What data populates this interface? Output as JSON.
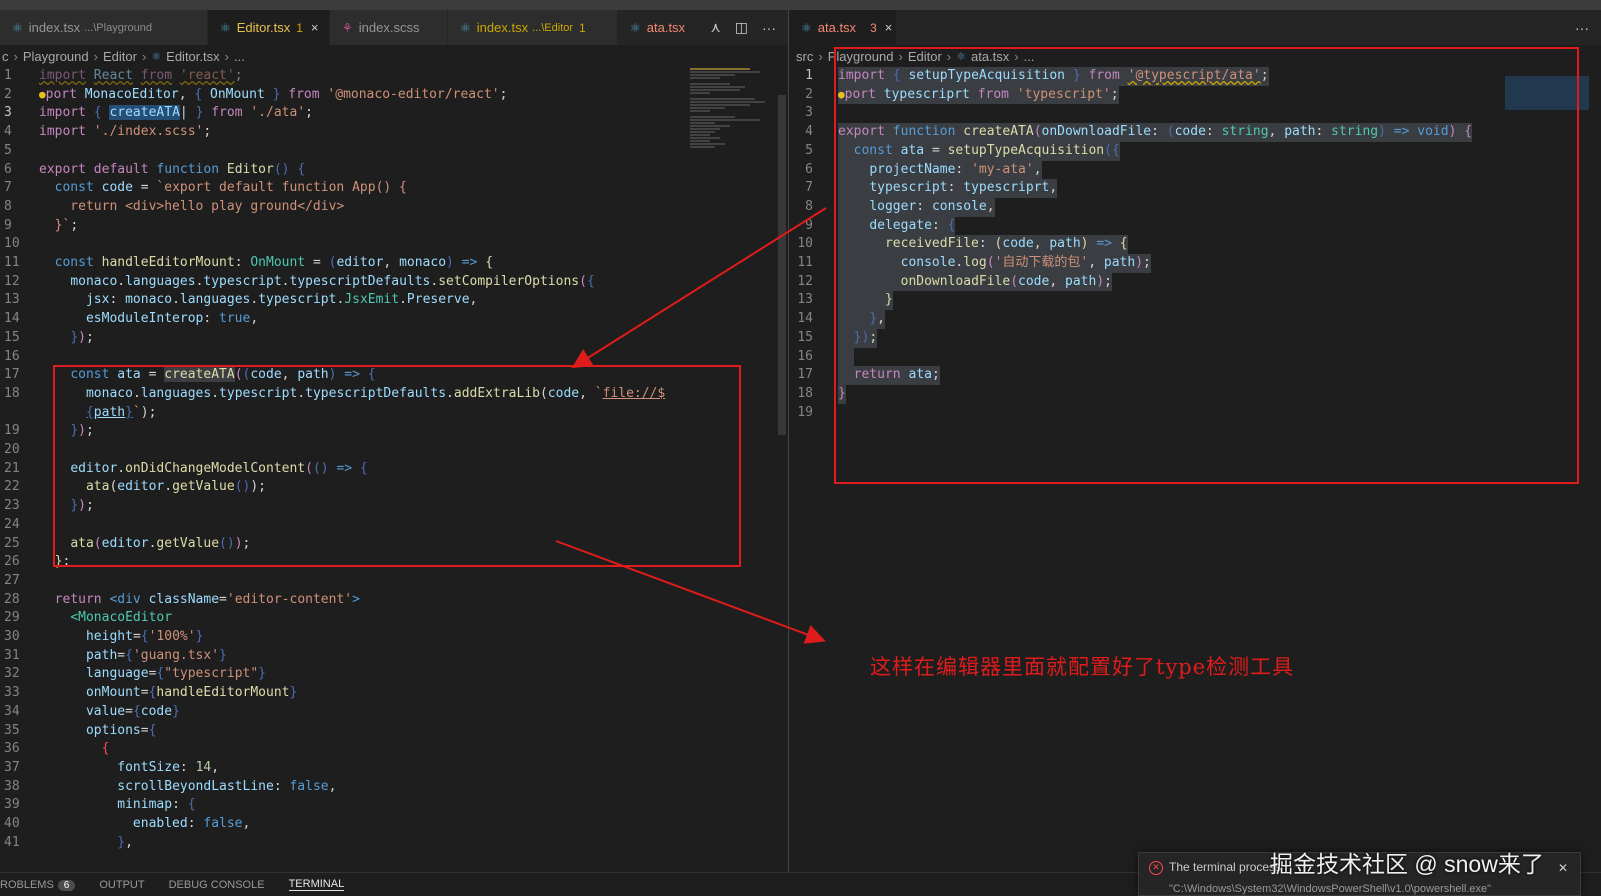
{
  "left": {
    "tabs": [
      {
        "label": "index.tsx",
        "hint": "...\\Playground"
      },
      {
        "label": "Editor.tsx",
        "badge": "1",
        "close": "×"
      },
      {
        "label": "index.scss"
      },
      {
        "label": "index.tsx",
        "hint": "...\\Editor",
        "badge": "1"
      },
      {
        "label": "ata.tsx"
      }
    ],
    "actions": {
      "compare": "⋏",
      "split": "◫",
      "more": "···"
    },
    "breadcrumb": [
      "c",
      "Playground",
      "Editor",
      "Editor.tsx",
      "..."
    ],
    "line_numbers": [
      "1",
      "2",
      "3",
      "4",
      "5",
      "6",
      "7",
      "8",
      "9",
      "10",
      "11",
      "12",
      "13",
      "14",
      "15",
      "16",
      "17",
      "18",
      "",
      "19",
      "20",
      "21",
      "22",
      "23",
      "24",
      "25",
      "26",
      "27",
      "28",
      "29",
      "30",
      "31",
      "32",
      "33",
      "34",
      "35",
      "36",
      "37",
      "38",
      "39",
      "40",
      "41"
    ]
  },
  "right": {
    "tab": {
      "label": "ata.tsx",
      "badge": "3",
      "close": "×"
    },
    "more": "···",
    "breadcrumb": [
      "src",
      "Playground",
      "Editor",
      "ata.tsx",
      "..."
    ],
    "line_numbers": [
      "1",
      "2",
      "3",
      "4",
      "5",
      "6",
      "7",
      "8",
      "9",
      "10",
      "11",
      "12",
      "13",
      "14",
      "15",
      "16",
      "17",
      "18",
      "19"
    ]
  },
  "annotation": "这样在编辑器里面就配置好了type检测工具",
  "panel": {
    "tabs": [
      "ROBLEMS",
      "OUTPUT",
      "DEBUG CONSOLE",
      "TERMINAL"
    ],
    "problems_count": "6"
  },
  "toast": {
    "title": "The terminal process",
    "detail": "\"C:\\Windows\\System32\\WindowsPowerShell\\v1.0\\powershell.exe\""
  },
  "watermark": "掘金技术社区 @ snow来了",
  "colors": {
    "annotation": "#e01b1b",
    "editor_bg": "#1e1e1e",
    "active_tab": "#e6c34d"
  }
}
